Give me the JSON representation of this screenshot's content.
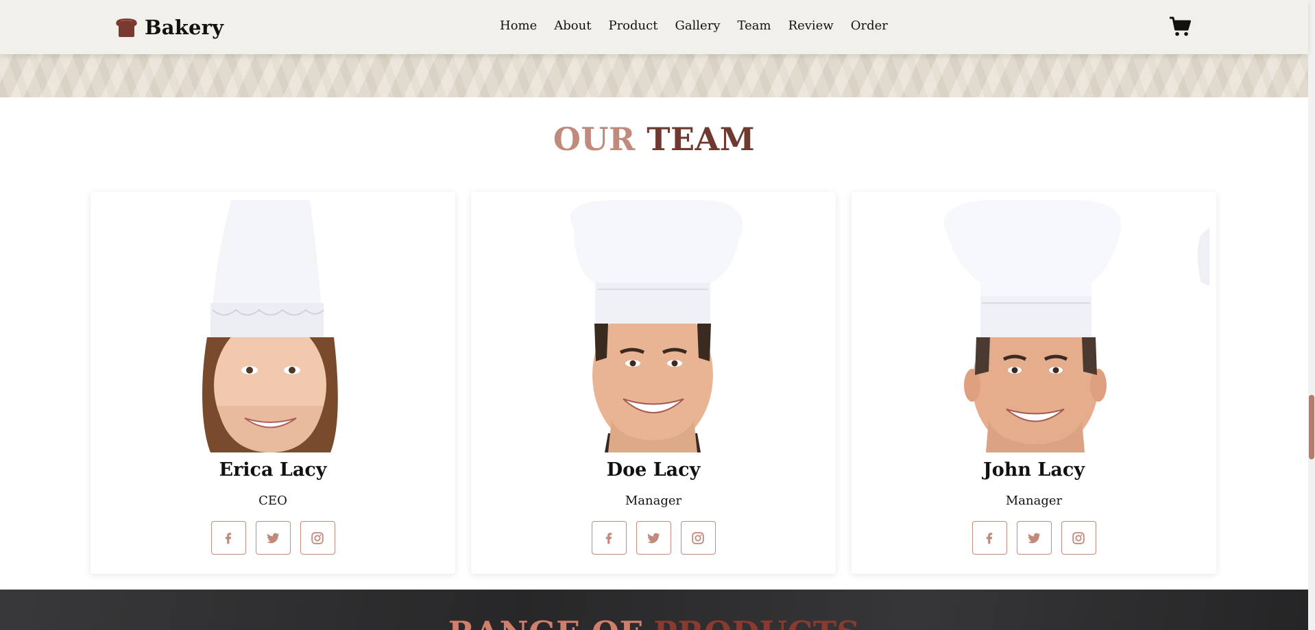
{
  "brand": {
    "name": "Bakery",
    "icon": "bread-icon"
  },
  "nav": {
    "items": [
      "Home",
      "About",
      "Product",
      "Gallery",
      "Team",
      "Review",
      "Order"
    ]
  },
  "cart": {
    "icon": "cart-icon"
  },
  "team": {
    "title_part1": "OUR",
    "title_part2": "TEAM",
    "members": [
      {
        "name": "Erica Lacy",
        "role": "CEO"
      },
      {
        "name": "Doe Lacy",
        "role": "Manager"
      },
      {
        "name": "John Lacy",
        "role": "Manager"
      }
    ],
    "social_icons": [
      "facebook-icon",
      "twitter-icon",
      "instagram-icon"
    ]
  },
  "products": {
    "title_part1": "RANGE OF",
    "title_part2": "PRODUCTS"
  },
  "colors": {
    "accent_light": "#c08a7c",
    "accent_dark": "#6e3a30",
    "header_bg": "#f2f0ea"
  }
}
